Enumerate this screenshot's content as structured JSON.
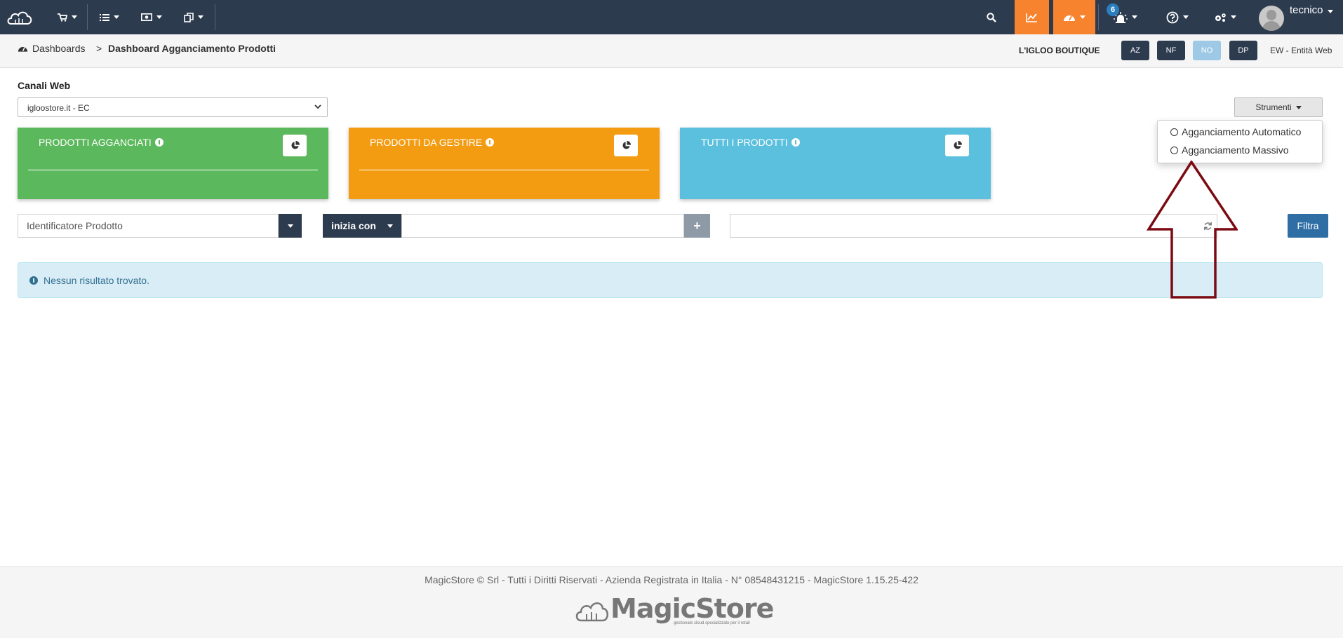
{
  "topbar": {
    "notification_count": "6",
    "user_name": "tecnico"
  },
  "breadcrumb": {
    "root": "Dashboards",
    "separator": ">",
    "current": "Dashboard Agganciamento Prodotti"
  },
  "header_right": {
    "company": "L'IGLOO BOUTIQUE",
    "buttons": [
      "AZ",
      "NF",
      "NO",
      "DP"
    ],
    "entity": "EW - Entità Web"
  },
  "canali": {
    "label": "Canali Web",
    "selected": "igloostore.it - EC"
  },
  "strumenti": {
    "label": "Strumenti",
    "menu": [
      "Agganciamento Automatico",
      "Agganciamento Massivo"
    ]
  },
  "cards": [
    {
      "title": "PRODOTTI AGGANCIATI",
      "color": "#5cb85c"
    },
    {
      "title": "PRODOTTI DA GESTIRE",
      "color": "#f39c12"
    },
    {
      "title": "TUTTI I PRODOTTI",
      "color": "#5bc0de"
    }
  ],
  "filters": {
    "identifier": "Identificatore Prodotto",
    "operator": "inizia con",
    "filter_button": "Filtra"
  },
  "alert": {
    "message": "Nessun risultato trovato."
  },
  "footer": {
    "text": "MagicStore © Srl - Tutti i Diritti Riservati - Azienda Registrata in Italia - N° 08548431215 - MagicStore 1.15.25-422",
    "logo_text": "MagicStore",
    "logo_tagline": "gestionale cloud specializzato per il retail"
  },
  "colors": {
    "topbar": "#2d3b4f",
    "accent_orange": "#f7832f",
    "annotation_arrow": "#7b0a12"
  }
}
